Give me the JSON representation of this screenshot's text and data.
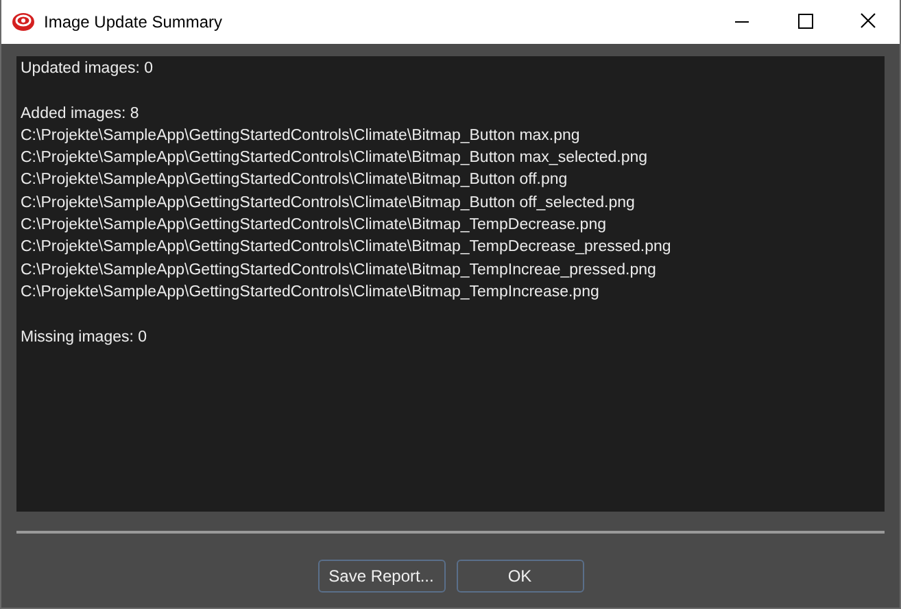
{
  "window": {
    "title": "Image Update Summary"
  },
  "report": [
    {
      "heading": "Updated images: 0"
    },
    {
      "heading": "Added images: 8",
      "files": [
        "C:\\Projekte\\SampleApp\\GettingStartedControls\\Climate\\Bitmap_Button max.png",
        "C:\\Projekte\\SampleApp\\GettingStartedControls\\Climate\\Bitmap_Button max_selected.png",
        "C:\\Projekte\\SampleApp\\GettingStartedControls\\Climate\\Bitmap_Button off.png",
        "C:\\Projekte\\SampleApp\\GettingStartedControls\\Climate\\Bitmap_Button off_selected.png",
        "C:\\Projekte\\SampleApp\\GettingStartedControls\\Climate\\Bitmap_TempDecrease.png",
        "C:\\Projekte\\SampleApp\\GettingStartedControls\\Climate\\Bitmap_TempDecrease_pressed.png",
        "C:\\Projekte\\SampleApp\\GettingStartedControls\\Climate\\Bitmap_TempIncreae_pressed.png",
        "C:\\Projekte\\SampleApp\\GettingStartedControls\\Climate\\Bitmap_TempIncrease.png"
      ]
    },
    {
      "heading": "Missing images: 0"
    }
  ],
  "buttons": [
    "Save Report...",
    "OK"
  ]
}
